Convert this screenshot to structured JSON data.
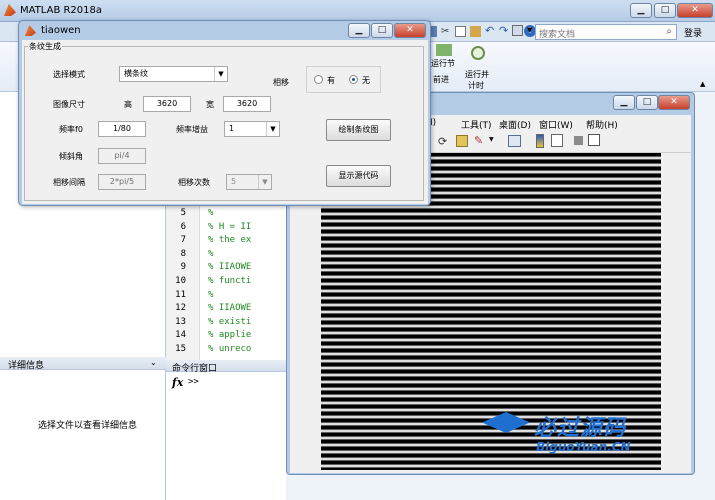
{
  "matlab": {
    "title": "MATLAB R2018a",
    "search_placeholder": "搜索文档",
    "login_label": "登录",
    "toolbar": {
      "run_section_label": "运行节",
      "advance_label": "前进",
      "run_time_label_1": "运行并",
      "run_time_label_2": "计时"
    },
    "details_panel": {
      "title": "详细信息",
      "message": "选择文件以查看详细信息"
    },
    "command_window": {
      "title": "命令行窗口",
      "prompt": ">>",
      "fx": "fx"
    },
    "editor_lines": [
      {
        "n": "5",
        "text": "%"
      },
      {
        "n": "6",
        "text": "%      H = II"
      },
      {
        "n": "7",
        "text": "%      the ex"
      },
      {
        "n": "8",
        "text": "%"
      },
      {
        "n": "9",
        "text": "%      IIAOWE"
      },
      {
        "n": "10",
        "text": "%      functi"
      },
      {
        "n": "11",
        "text": "%"
      },
      {
        "n": "12",
        "text": "%      IIAOWE"
      },
      {
        "n": "13",
        "text": "%      existi"
      },
      {
        "n": "14",
        "text": "%      applie"
      },
      {
        "n": "15",
        "text": "%      unreco"
      }
    ]
  },
  "figure": {
    "menu": [
      "I)",
      "工具(T)",
      "桌面(D)",
      "窗口(W)",
      "帮助(H)"
    ]
  },
  "dialog": {
    "title": "tiaowen",
    "group_title": "条纹生成",
    "mode_label": "选择模式",
    "mode_value": "横条纹",
    "phase_shift_label": "相移",
    "phase_yes": "有",
    "phase_no": "无",
    "phase_selected": "无",
    "image_size_label": "图像尺寸",
    "height_label": "高",
    "height_value": "3620",
    "width_label": "宽",
    "width_value": "3620",
    "freq_label": "频率f0",
    "freq_value": "1/80",
    "freq_gain_label": "频率增益",
    "freq_gain_value": "1",
    "tilt_label": "倾斜角",
    "tilt_value": "pi/4",
    "phase_interval_label": "相移间隔",
    "phase_interval_value": "2*pi/5",
    "phase_count_label": "相移次数",
    "phase_count_value": "5",
    "draw_button": "绘制条纹图",
    "show_code_button": "显示源代码"
  },
  "watermark": {
    "text_main": "必过源码",
    "text_url": "BiguoYuan.CN"
  }
}
